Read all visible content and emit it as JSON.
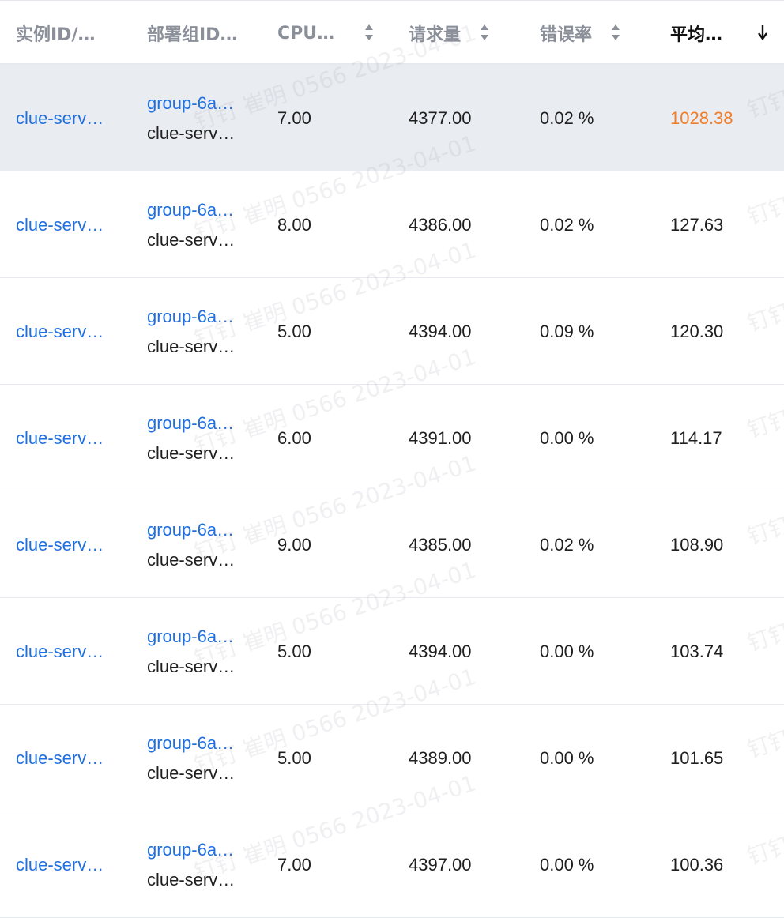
{
  "columns": [
    {
      "label": "实例ID/…",
      "sortable": false,
      "active": false
    },
    {
      "label": "部署组ID…",
      "sortable": false,
      "active": false
    },
    {
      "label": "CPU…",
      "sortable": true,
      "active": false
    },
    {
      "label": "请求量",
      "sortable": true,
      "active": false
    },
    {
      "label": "错误率",
      "sortable": true,
      "active": false
    },
    {
      "label": "平均…",
      "sortable": true,
      "active": true,
      "sort_direction": "desc"
    }
  ],
  "rows": [
    {
      "instance": "clue-serv…",
      "group_id": "group-6a…",
      "group_name": "clue-serv…",
      "cpu": "7.00",
      "requests": "4377.00",
      "error_rate": "0.02 %",
      "avg": "1028.38",
      "highlighted": true
    },
    {
      "instance": "clue-serv…",
      "group_id": "group-6a…",
      "group_name": "clue-serv…",
      "cpu": "8.00",
      "requests": "4386.00",
      "error_rate": "0.02 %",
      "avg": "127.63",
      "highlighted": false
    },
    {
      "instance": "clue-serv…",
      "group_id": "group-6a…",
      "group_name": "clue-serv…",
      "cpu": "5.00",
      "requests": "4394.00",
      "error_rate": "0.09 %",
      "avg": "120.30",
      "highlighted": false
    },
    {
      "instance": "clue-serv…",
      "group_id": "group-6a…",
      "group_name": "clue-serv…",
      "cpu": "6.00",
      "requests": "4391.00",
      "error_rate": "0.00 %",
      "avg": "114.17",
      "highlighted": false
    },
    {
      "instance": "clue-serv…",
      "group_id": "group-6a…",
      "group_name": "clue-serv…",
      "cpu": "9.00",
      "requests": "4385.00",
      "error_rate": "0.02 %",
      "avg": "108.90",
      "highlighted": false
    },
    {
      "instance": "clue-serv…",
      "group_id": "group-6a…",
      "group_name": "clue-serv…",
      "cpu": "5.00",
      "requests": "4394.00",
      "error_rate": "0.00 %",
      "avg": "103.74",
      "highlighted": false
    },
    {
      "instance": "clue-serv…",
      "group_id": "group-6a…",
      "group_name": "clue-serv…",
      "cpu": "5.00",
      "requests": "4389.00",
      "error_rate": "0.00 %",
      "avg": "101.65",
      "highlighted": false
    },
    {
      "instance": "clue-serv…",
      "group_id": "group-6a…",
      "group_name": "clue-serv…",
      "cpu": "7.00",
      "requests": "4397.00",
      "error_rate": "0.00 %",
      "avg": "100.36",
      "highlighted": false
    }
  ],
  "watermark": {
    "text": "钉钉 崔明 0566 2023-04-01"
  },
  "colors": {
    "link": "#1f6fe0",
    "highlight_value": "#ef7d2a",
    "highlight_row": "#e9ecf1",
    "header_text": "#8a8f99",
    "active_header": "#111111"
  },
  "icons": {
    "sortable": "sort-up-down-icon",
    "sort_desc": "arrow-down-icon"
  }
}
